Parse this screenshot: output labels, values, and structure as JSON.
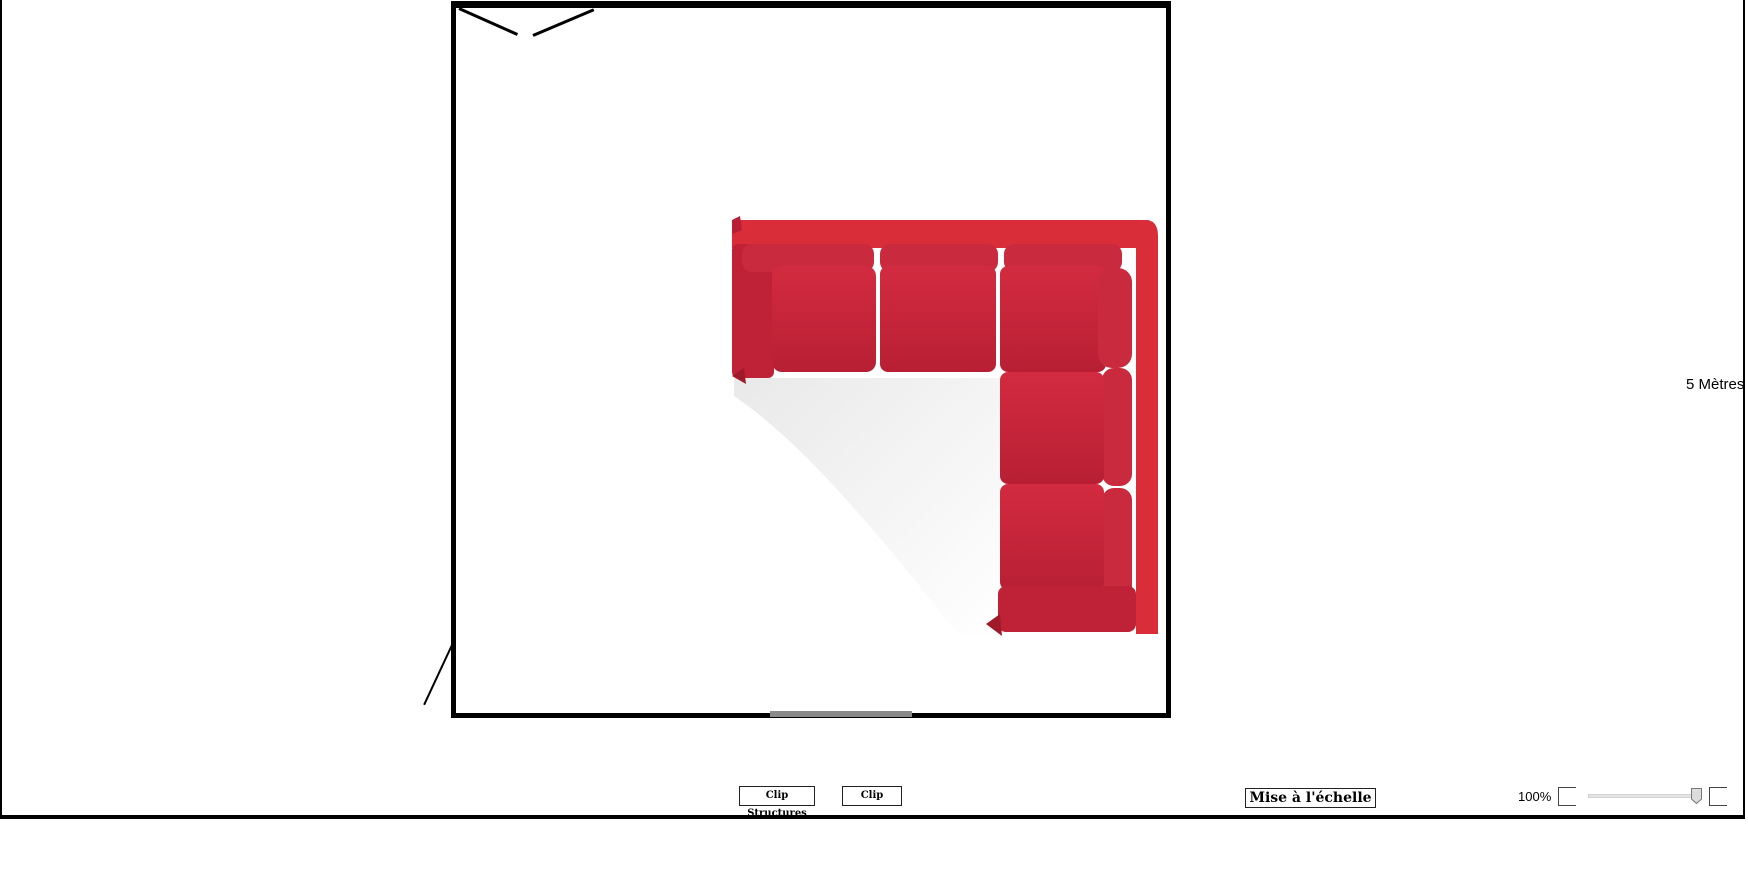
{
  "canvas": {
    "scale_label": "5 Mètres"
  },
  "room": {
    "items": [
      {
        "name": "corner-sofa",
        "color": "#c8233a"
      }
    ]
  },
  "toolbar": {
    "clip_structures_label": "Clip Structures",
    "clip_label": "Clip",
    "scale_button_label": "Mise à l'échelle",
    "zoom_label": "100%",
    "zoom_slider_fraction": 1.0
  },
  "colors": {
    "wall": "#000000",
    "opening": "#8a8a8a",
    "sofa": "#c8233a",
    "sofa_dark": "#a01a2c",
    "sofa_frame": "#d92d3a"
  },
  "icons": {
    "slider_thumb": "slider-thumb-icon"
  }
}
